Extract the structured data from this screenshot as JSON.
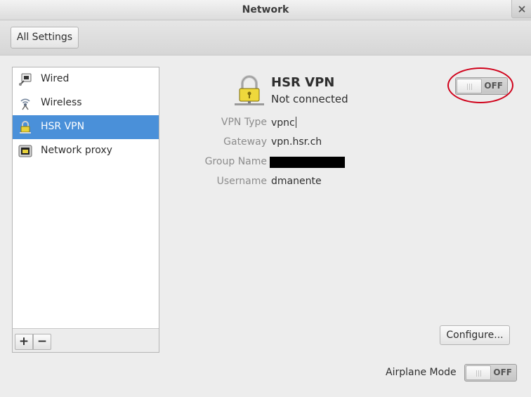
{
  "window": {
    "title": "Network"
  },
  "toolbar": {
    "all_settings_label": "All Settings"
  },
  "sidebar": {
    "items": [
      {
        "label": "Wired",
        "icon": "wired-network-icon",
        "selected": false
      },
      {
        "label": "Wireless",
        "icon": "wireless-network-icon",
        "selected": false
      },
      {
        "label": "HSR VPN",
        "icon": "vpn-lock-icon",
        "selected": true
      },
      {
        "label": "Network proxy",
        "icon": "network-proxy-icon",
        "selected": false
      }
    ],
    "add_label": "+",
    "remove_label": "−"
  },
  "details": {
    "name": "HSR VPN",
    "status": "Not connected",
    "switch_state": "OFF",
    "properties": {
      "vpn_type": {
        "label": "VPN Type",
        "value": "vpnc"
      },
      "gateway": {
        "label": "Gateway",
        "value": "vpn.hsr.ch"
      },
      "group_name": {
        "label": "Group Name",
        "value": ""
      },
      "username": {
        "label": "Username",
        "value": "dmanente"
      }
    },
    "configure_label": "Configure..."
  },
  "airplane": {
    "label": "Airplane Mode",
    "state": "OFF"
  },
  "colors": {
    "selection": "#4a90d9",
    "highlight_circle": "#d0021b"
  }
}
